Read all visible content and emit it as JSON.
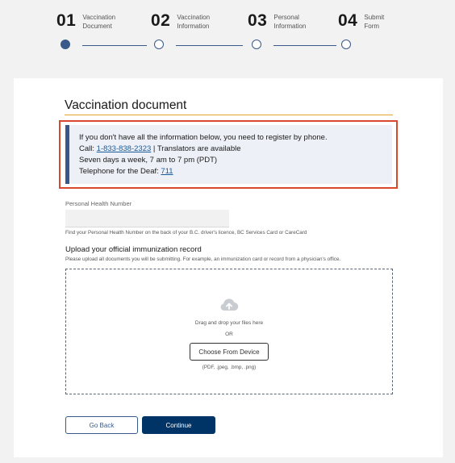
{
  "stepper": {
    "steps": [
      {
        "number": "01",
        "label_line1": "Vaccination",
        "label_line2": "Document",
        "state": "active"
      },
      {
        "number": "02",
        "label_line1": "Vaccination",
        "label_line2": "Information",
        "state": "inactive"
      },
      {
        "number": "03",
        "label_line1": "Personal",
        "label_line2": "Information",
        "state": "inactive"
      },
      {
        "number": "04",
        "label_line1": "Submit",
        "label_line2": "Form",
        "state": "inactive"
      }
    ]
  },
  "page": {
    "title": "Vaccination document"
  },
  "callout": {
    "line1": "If you don't have all the information below, you need to register by phone.",
    "call_prefix": "Call: ",
    "call_phone": "1-833-838-2323",
    "call_suffix": " | Translators are available",
    "hours": "Seven days a week, 7 am to 7 pm (PDT)",
    "deaf_prefix": "Telephone for the Deaf: ",
    "deaf_number": "711"
  },
  "phn": {
    "label": "Personal Health Number",
    "value": "",
    "placeholder": "",
    "help": "Find your Personal Health Number on the back of your B.C. driver's licence, BC Services Card or CareCard"
  },
  "upload": {
    "heading": "Upload your official immunization record",
    "description": "Please upload all documents you will be submitting. For example, an immunization card or record from a physician's office.",
    "drag_text": "Drag and drop your files here",
    "or_text": "OR",
    "choose_label": "Choose From Device",
    "formats": "(PDF, .jpeg, .bmp, .png)",
    "icon": "cloud-upload-icon"
  },
  "actions": {
    "back_label": "Go Back",
    "continue_label": "Continue"
  },
  "colors": {
    "primary": "#003366",
    "accent": "#38598a",
    "title_underline": "#e3a82b",
    "callout_highlight": "#d8492e",
    "callout_bg": "#eef0f7",
    "link": "#1a5a96"
  }
}
